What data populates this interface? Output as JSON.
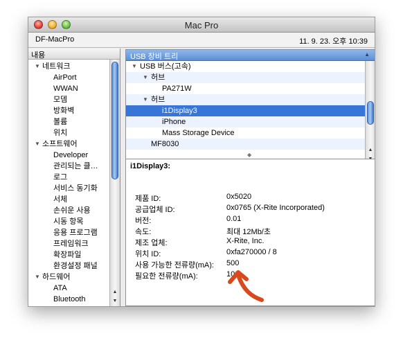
{
  "window": {
    "title": "Mac Pro"
  },
  "infobar": {
    "machine": "DF-MacPro",
    "datetime": "11. 9. 23. 오후 10:39"
  },
  "sidebar": {
    "header": "내용",
    "items": [
      {
        "label": "네트워크",
        "level": 0,
        "disclosure": "▼"
      },
      {
        "label": "AirPort",
        "level": 1
      },
      {
        "label": "WWAN",
        "level": 1
      },
      {
        "label": "모뎀",
        "level": 1
      },
      {
        "label": "방화벽",
        "level": 1
      },
      {
        "label": "볼륨",
        "level": 1
      },
      {
        "label": "위치",
        "level": 1
      },
      {
        "label": "소프트웨어",
        "level": 0,
        "disclosure": "▼"
      },
      {
        "label": "Developer",
        "level": 1
      },
      {
        "label": "관리되는 클…",
        "level": 1
      },
      {
        "label": "로그",
        "level": 1
      },
      {
        "label": "서비스 동기화",
        "level": 1
      },
      {
        "label": "서체",
        "level": 1
      },
      {
        "label": "손쉬운 사용",
        "level": 1
      },
      {
        "label": "시동 항목",
        "level": 1
      },
      {
        "label": "응용 프로그램",
        "level": 1
      },
      {
        "label": "프레임워크",
        "level": 1
      },
      {
        "label": "확장파일",
        "level": 1
      },
      {
        "label": "환경설정 패널",
        "level": 1
      },
      {
        "label": "하드웨어",
        "level": 0,
        "disclosure": "▼"
      },
      {
        "label": "ATA",
        "level": 1
      },
      {
        "label": "Bluetooth",
        "level": 1
      }
    ]
  },
  "usb_tree": {
    "header": "USB 장비 트리",
    "sort_indicator": "▲",
    "rows": [
      {
        "label": "USB 버스(고속)",
        "indent": 1,
        "disclosure": "▼"
      },
      {
        "label": "허브",
        "indent": 2,
        "disclosure": "▼"
      },
      {
        "label": "PA271W",
        "indent": 3
      },
      {
        "label": "허브",
        "indent": 2,
        "disclosure": "▼"
      },
      {
        "label": "i1Display3",
        "indent": 3,
        "selected": true
      },
      {
        "label": "iPhone",
        "indent": 3
      },
      {
        "label": "Mass Storage Device",
        "indent": 3
      },
      {
        "label": "MF8030",
        "indent": 2
      }
    ]
  },
  "detail": {
    "title": "i1Display3:",
    "properties": [
      {
        "key": "제품 ID:",
        "value": "0x5020"
      },
      {
        "key": "공급업체 ID:",
        "value": "0x0765  (X-Rite Incorporated)"
      },
      {
        "key": "버전:",
        "value": "0.01"
      },
      {
        "key": "속도:",
        "value": "최대 12Mb/초"
      },
      {
        "key": "제조 업체:",
        "value": "X-Rite, Inc."
      },
      {
        "key": "위치 ID:",
        "value": "0xfa270000 / 8"
      },
      {
        "key": "사용 가능한 전류량(mA):",
        "value": "500"
      },
      {
        "key": "필요한 전류량(mA):",
        "value": "100"
      }
    ]
  },
  "colors": {
    "selection": "#3875d7",
    "annotation": "#d84a1b"
  }
}
